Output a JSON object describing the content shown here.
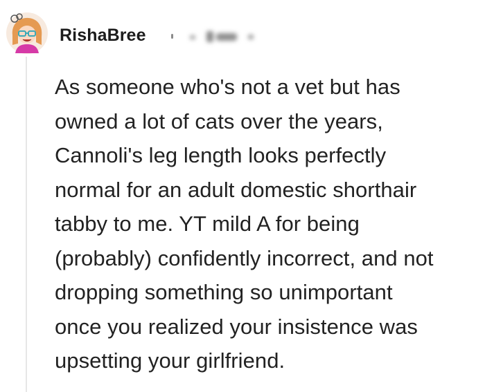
{
  "comment": {
    "author": "RishaBree",
    "body_lines": [
      "As someone who's not a vet but has",
      "owned a lot of cats over the years,",
      "Cannoli's leg length looks perfectly",
      "normal for an adult domestic shorthair",
      "tabby to me. YT mild A for being",
      "(probably) confidently incorrect, and not",
      "dropping something so unimportant",
      "once you realized your insistence was",
      "upsetting your girlfriend."
    ]
  },
  "icons": {
    "avatar": "cartoon-avatar-icon",
    "separator": "separator-dot-icon"
  },
  "colors": {
    "text": "#222222",
    "username": "#1c1c1c",
    "thread_line": "#e6e6e6",
    "avatar_ring": "#f3e3d6",
    "avatar_hair": "#e59a52",
    "avatar_shirt": "#d63aa7",
    "avatar_glasses": "#3aa9b8"
  }
}
